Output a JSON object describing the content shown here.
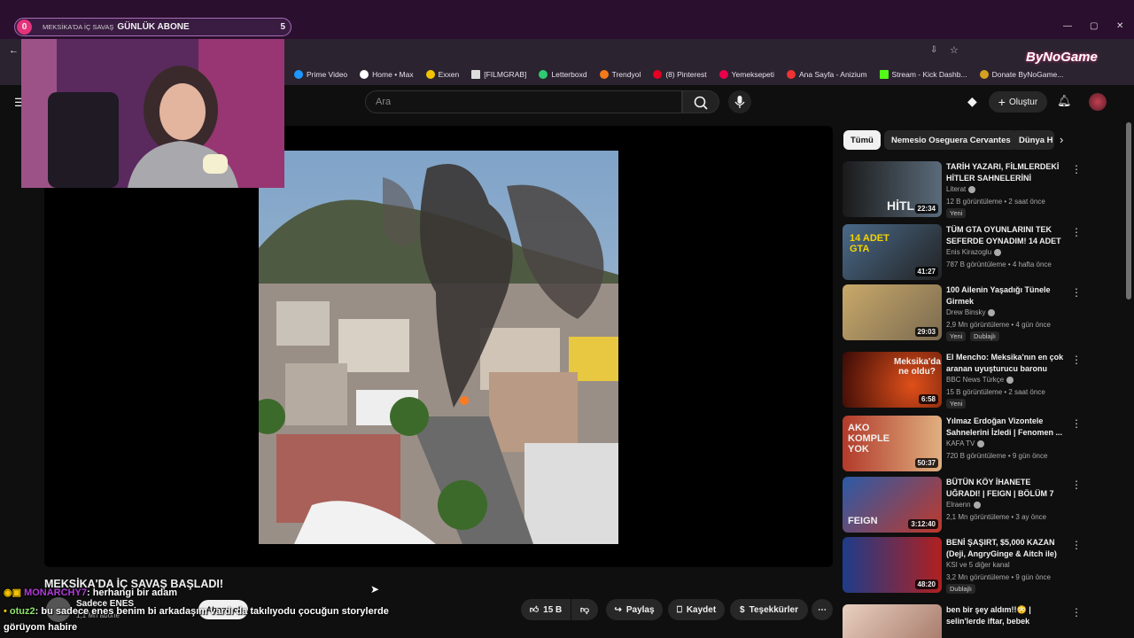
{
  "overlay": {
    "count_left": "0",
    "ticker": "MEKSİKA'DA İÇ SAVAŞ",
    "label": "GÜNLÜK ABONE",
    "count_right": "5"
  },
  "bookmarks": [
    "Prime Video",
    "Home • Max",
    "Exxen",
    "[FILMGRAB]",
    "Letterboxd",
    "Trendyol",
    "(8) Pinterest",
    "Yemeksepeti",
    "Ana Sayfa - Anizium",
    "Stream - Kick Dashb...",
    "Donate ByNoGame..."
  ],
  "brand": "ByNoGame",
  "search": {
    "placeholder": "Ara"
  },
  "header": {
    "create_label": "Oluştur"
  },
  "video": {
    "title": "MEKSİKA'DA İÇ SAVAŞ BAŞLADI!",
    "channel": "Sadece ENES",
    "subs": "1,1 Mn abone",
    "subscribe_label": "Abone ol",
    "likes": "15 B",
    "share_label": "Paylaş",
    "save_label": "Kaydet",
    "thanks_label": "Teşekkürler"
  },
  "chat": [
    {
      "user": "MONARCHY7",
      "msg": ": herhangi bir adam"
    },
    {
      "user": "otuz2",
      "msg": ": bu sadece enes benim bi arkadaşım vardı da takılıyodu çocuğun storylerde"
    },
    {
      "user": "",
      "msg": "görüyom habire"
    }
  ],
  "chips": [
    "Tümü",
    "Nemesio Oseguera Cervantes",
    "Dünya H"
  ],
  "recommendations": [
    {
      "title": "TARİH YAZARI, FİLMLERDEKİ HİTLER SAHNELERİNİ İZLİYOR!",
      "channel": "Literat",
      "meta": "12 B görüntüleme • 2 saat önce",
      "duration": "22:34",
      "badge": "Yeni",
      "badge2": "",
      "thumb_text": "HİTL",
      "c1": "#5a6b7a",
      "c2": "#1a1a1a"
    },
    {
      "title": "TÜM GTA OYUNLARINI TEK SEFERDE OYNADIM! 14 ADET ...",
      "channel": "Enis Kirazoglu",
      "meta": "787 B görüntüleme • 4 hafta önce",
      "duration": "41:27",
      "badge": "",
      "badge2": "",
      "thumb_text": "14 ADET GTA",
      "c1": "#4a6a8a",
      "c2": "#222"
    },
    {
      "title": "100 Ailenin Yaşadığı Tünele Girmek",
      "channel": "Drew Binsky",
      "meta": "2,9 Mn görüntüleme • 4 gün önce",
      "duration": "29:03",
      "badge": "Yeni",
      "badge2": "Dublajlı",
      "thumb_text": "",
      "c1": "#7a6a50",
      "c2": "#c9a96a"
    },
    {
      "title": "El Mencho: Meksika'nın en çok aranan uyuşturucu baronu nas...",
      "channel": "BBC News Türkçe",
      "meta": "15 B görüntüleme • 2 saat önce",
      "duration": "6:58",
      "badge": "Yeni",
      "badge2": "",
      "thumb_text": "Meksika'da ne oldu?",
      "c1": "#a0281a",
      "c2": "#3a0a06"
    },
    {
      "title": "Yılmaz Erdoğan Vizontele Sahnelerini İzledi | Fenomen ...",
      "channel": "KAFA TV",
      "meta": "720 B görüntüleme • 9 gün önce",
      "duration": "50:37",
      "badge": "",
      "badge2": "",
      "thumb_text": "AKO KOMPLE YOK",
      "c1": "#b23a2a",
      "c2": "#e0b080"
    },
    {
      "title": "BÜTÜN KÖY İHANETE UĞRADI! | FEIGN | BÖLÜM 7",
      "channel": "Elraenn",
      "meta": "2,1 Mn görüntüleme • 3 ay önce",
      "duration": "3:12:40",
      "badge": "",
      "badge2": "",
      "thumb_text": "FEIGN",
      "c1": "#2a5aa8",
      "c2": "#c0392b"
    },
    {
      "title": "BENİ ŞAŞIRT, $5,000 KAZAN (Deji, AngryGinge & Aitch ile)",
      "channel": "KSI ve 5 diğer kanal",
      "meta": "3,2 Mn görüntüleme • 9 gün önce",
      "duration": "48:20",
      "badge": "Dublajlı",
      "badge2": "",
      "thumb_text": "",
      "c1": "#1e3c8a",
      "c2": "#b02020"
    },
    {
      "title": "ben bir şey aldım!!😳 | selin'lerde iftar, bebek",
      "channel": "",
      "meta": "",
      "duration": "",
      "badge": "",
      "badge2": "",
      "thumb_text": "",
      "c1": "#e8d0c0",
      "c2": "#a07060"
    }
  ],
  "colors": {
    "accent": "#e4337a",
    "youtube_bg": "#0f0f0f",
    "chat_user1": "#b03bd8",
    "chat_user2": "#8ee36a"
  }
}
